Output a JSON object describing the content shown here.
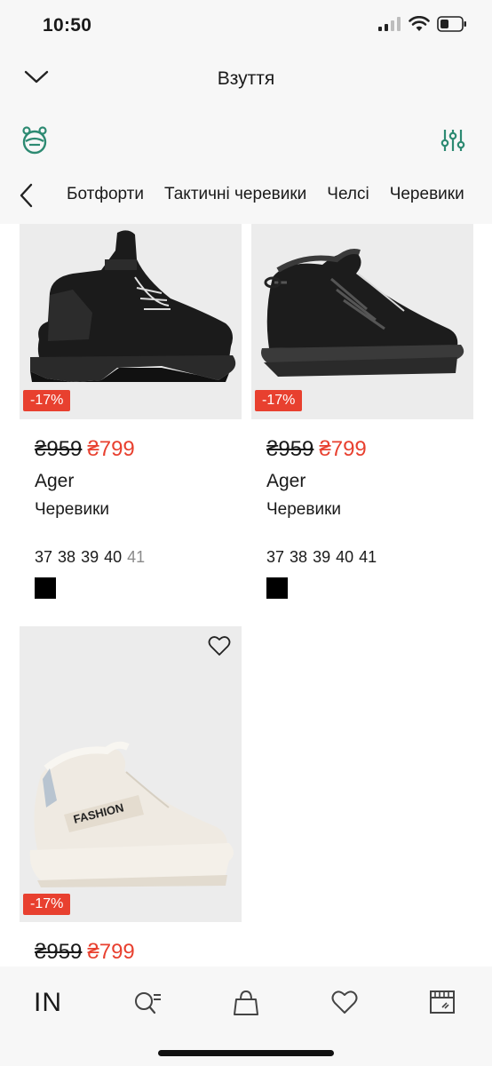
{
  "status_bar": {
    "time": "10:50"
  },
  "header": {
    "title": "Взуття"
  },
  "categories": [
    "Ботфорти",
    "Тактичні черевики",
    "Челсі",
    "Черевики"
  ],
  "products": [
    {
      "discount": "-17%",
      "old_price": "₴959",
      "new_price": "₴799",
      "brand": "Ager",
      "type": "Черевики",
      "sizes": [
        {
          "label": "37",
          "available": true
        },
        {
          "label": "38",
          "available": true
        },
        {
          "label": "39",
          "available": true
        },
        {
          "label": "40",
          "available": true
        },
        {
          "label": "41",
          "available": false
        }
      ],
      "color": "#000000"
    },
    {
      "discount": "-17%",
      "old_price": "₴959",
      "new_price": "₴799",
      "brand": "Ager",
      "type": "Черевики",
      "sizes": [
        {
          "label": "37",
          "available": true
        },
        {
          "label": "38",
          "available": true
        },
        {
          "label": "39",
          "available": true
        },
        {
          "label": "40",
          "available": true
        },
        {
          "label": "41",
          "available": true
        }
      ],
      "color": "#000000"
    },
    {
      "discount": "-17%",
      "old_price": "₴959",
      "new_price": "₴799",
      "shoe_text": "FASHION"
    }
  ],
  "tabbar": {
    "home_label": "IN"
  }
}
